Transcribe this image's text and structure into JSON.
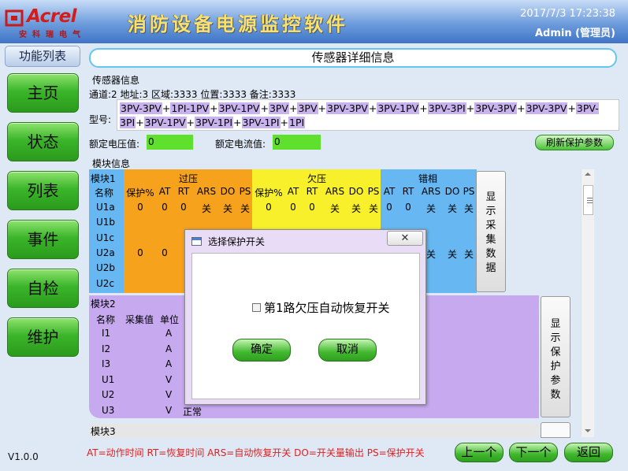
{
  "header": {
    "logo_brand": "Acrel",
    "logo_sub": "安科瑞电气",
    "title": "消防设备电源监控软件",
    "datetime": "2017/7/3 17:23:38",
    "user": "Admin (管理员)"
  },
  "sidebar": {
    "title": "功能列表",
    "items": [
      "主页",
      "状态",
      "列表",
      "事件",
      "自检",
      "维护"
    ],
    "version": "V1.0.0"
  },
  "main": {
    "title": "传感器详细信息"
  },
  "sensor": {
    "group_label": "传感器信息",
    "info_line": "通道:2  地址:3  区域:3333  位置:3333  备注:3333",
    "model_label": "型号:",
    "model_tokens": [
      "3PV-3PV",
      "1PI-1PV",
      "3PV-1PV",
      "3PV",
      "3PV",
      "3PV-3PV",
      "3PV-1PV",
      "3PV-3PI",
      "3PV-3PV",
      "3PV-3PV",
      "3PV-3PI",
      "3PV-1PV",
      "3PV-1PI",
      "3PV-1PI",
      "1PI"
    ],
    "voltage_label": "额定电压值:",
    "voltage_value": "0",
    "current_label": "额定电流值:",
    "current_value": "0",
    "refresh_label": "刷新保护参数"
  },
  "modules": {
    "group_label": "模块信息",
    "module1": {
      "name": "模块1",
      "groups": [
        "过压",
        "欠压",
        "错相"
      ],
      "header_name": "名称",
      "cols_ov": [
        "保护%",
        "AT",
        "RT",
        "ARS",
        "DO",
        "PS"
      ],
      "cols_uv": [
        "保护%",
        "AT",
        "RT",
        "ARS",
        "DO",
        "PS"
      ],
      "cols_ph": [
        "AT",
        "RT",
        "ARS",
        "DO",
        "PS"
      ],
      "rows": [
        "U1a",
        "U1b",
        "U1c",
        "U2a",
        "U2b",
        "U2c"
      ],
      "u1a_ov": [
        "0",
        "0",
        "0",
        "关",
        "关",
        "关"
      ],
      "u1a_uv": [
        "0",
        "0",
        "0",
        "关",
        "关",
        "关"
      ],
      "u1a_ph": [
        "0",
        "0",
        "关",
        "关",
        "关"
      ],
      "u2a_ov": [
        "0",
        "0"
      ],
      "u2a_ph_tail": [
        "关",
        "关",
        "关"
      ],
      "show_label": "显示采集数据"
    },
    "module2": {
      "name": "模块2",
      "headers": [
        "名称",
        "采集值",
        "单位"
      ],
      "rows": [
        {
          "name": "I1",
          "unit": "A"
        },
        {
          "name": "I2",
          "unit": "A"
        },
        {
          "name": "I3",
          "unit": "A"
        },
        {
          "name": "U1",
          "unit": "V"
        },
        {
          "name": "U2",
          "unit": "V"
        },
        {
          "name": "U3",
          "unit": "V",
          "status": "正常"
        }
      ],
      "show_label": "显示保护参数"
    },
    "module3": {
      "name": "模块3"
    }
  },
  "footer": {
    "legend": "AT=动作时间  RT=恢复时间  ARS=自动恢复开关  DO=开关量输出  PS=保护开关",
    "prev": "上一个",
    "next": "下一个",
    "back": "返回"
  },
  "dialog": {
    "title": "选择保护开关",
    "close_glyph": "✕",
    "checkbox_label": "第1路欠压自动恢复开关",
    "ok": "确定",
    "cancel": "取消"
  },
  "colors": {
    "overvoltage": "#f6a21c",
    "undervoltage": "#f8f02a",
    "phase": "#66b7f2",
    "module2": "#c6a9ee",
    "button_green": "#3bb52a",
    "value_green": "#5ee02c"
  }
}
